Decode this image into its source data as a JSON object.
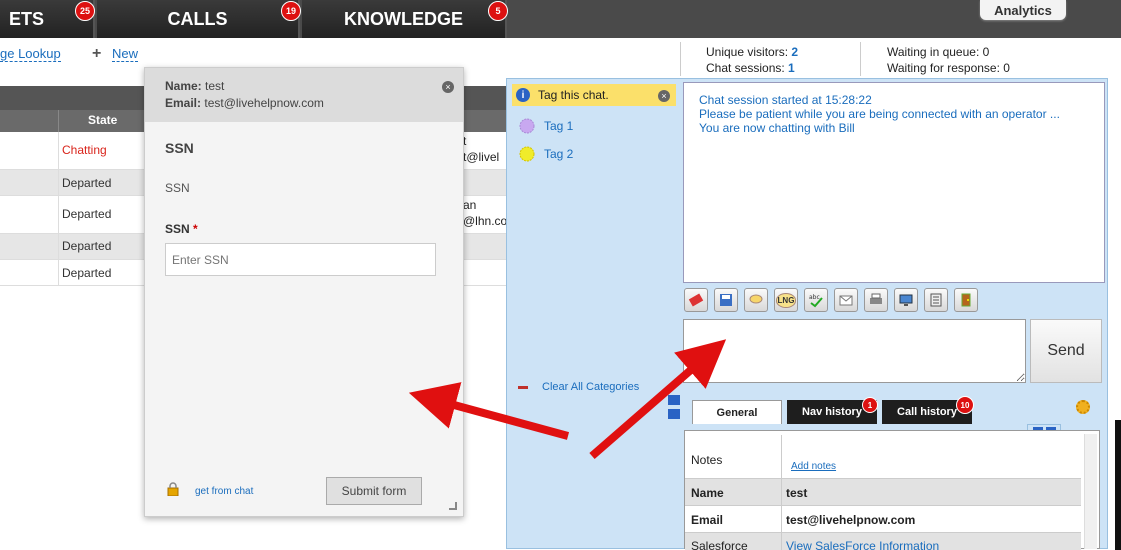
{
  "nav": {
    "tabs": [
      {
        "label": "ETS",
        "badge": "25"
      },
      {
        "label": "CALLS",
        "badge": "19"
      },
      {
        "label": "KNOWLEDGE",
        "badge": "5"
      }
    ],
    "analytics": "Analytics"
  },
  "toolbar": {
    "lookup": "ge Lookup",
    "new_label": "New"
  },
  "stats": {
    "unique_visitors_label": "Unique visitors:",
    "unique_visitors": "2",
    "chat_sessions_label": "Chat sessions:",
    "chat_sessions": "1",
    "waiting_queue": "Waiting in queue: 0",
    "waiting_response": "Waiting for response: 0"
  },
  "table": {
    "state_header": "State",
    "rows": [
      {
        "state": "Chatting",
        "extra1": "t",
        "extra2": "t@livel"
      },
      {
        "state": "Departed",
        "extra1": "",
        "extra2": ""
      },
      {
        "state": "Departed",
        "extra1": "an",
        "extra2": "@lhn.co"
      },
      {
        "state": "Departed",
        "extra1": "",
        "extra2": ""
      },
      {
        "state": "Departed",
        "extra1": "",
        "extra2": ""
      }
    ],
    "chatting_color": "#d9241b"
  },
  "popup": {
    "name_label": "Name:",
    "name_value": "test",
    "email_label": "Email:",
    "email_value": "test@livehelpnow.com",
    "title": "SSN",
    "subtitle": "SSN",
    "field_label": "SSN",
    "required_mark": "*",
    "placeholder": "Enter SSN",
    "get_from_chat": "get from chat",
    "submit": "Submit form"
  },
  "tags": {
    "active": "Tag this chat.",
    "items": [
      {
        "label": "Tag 1",
        "color": "#c8a8f0"
      },
      {
        "label": "Tag 2",
        "color": "#f0ec2a"
      }
    ],
    "clear": "Clear All Categories"
  },
  "chat": {
    "lines": [
      "Chat session started at 15:28:22",
      "Please be patient while you are being connected with an operator ...",
      "You are now chatting with Bill"
    ],
    "send": "Send"
  },
  "subtabs": {
    "general": "General",
    "nav_history": "Nav history",
    "nav_history_badge": "1",
    "call_history": "Call history",
    "call_history_badge": "10"
  },
  "details": {
    "rows": [
      {
        "key": "Notes",
        "value": "Add notes"
      },
      {
        "key": "Name",
        "value": "test"
      },
      {
        "key": "Email",
        "value": "test@livehelpnow.com"
      },
      {
        "key": "Salesforce",
        "value": "View SalesForce Information"
      }
    ]
  },
  "colors": {
    "accent_blue": "#1a6dbd",
    "badge_red": "#dd1111",
    "tag_highlight": "#fbe06a",
    "chat_panel": "#cde3f6"
  }
}
